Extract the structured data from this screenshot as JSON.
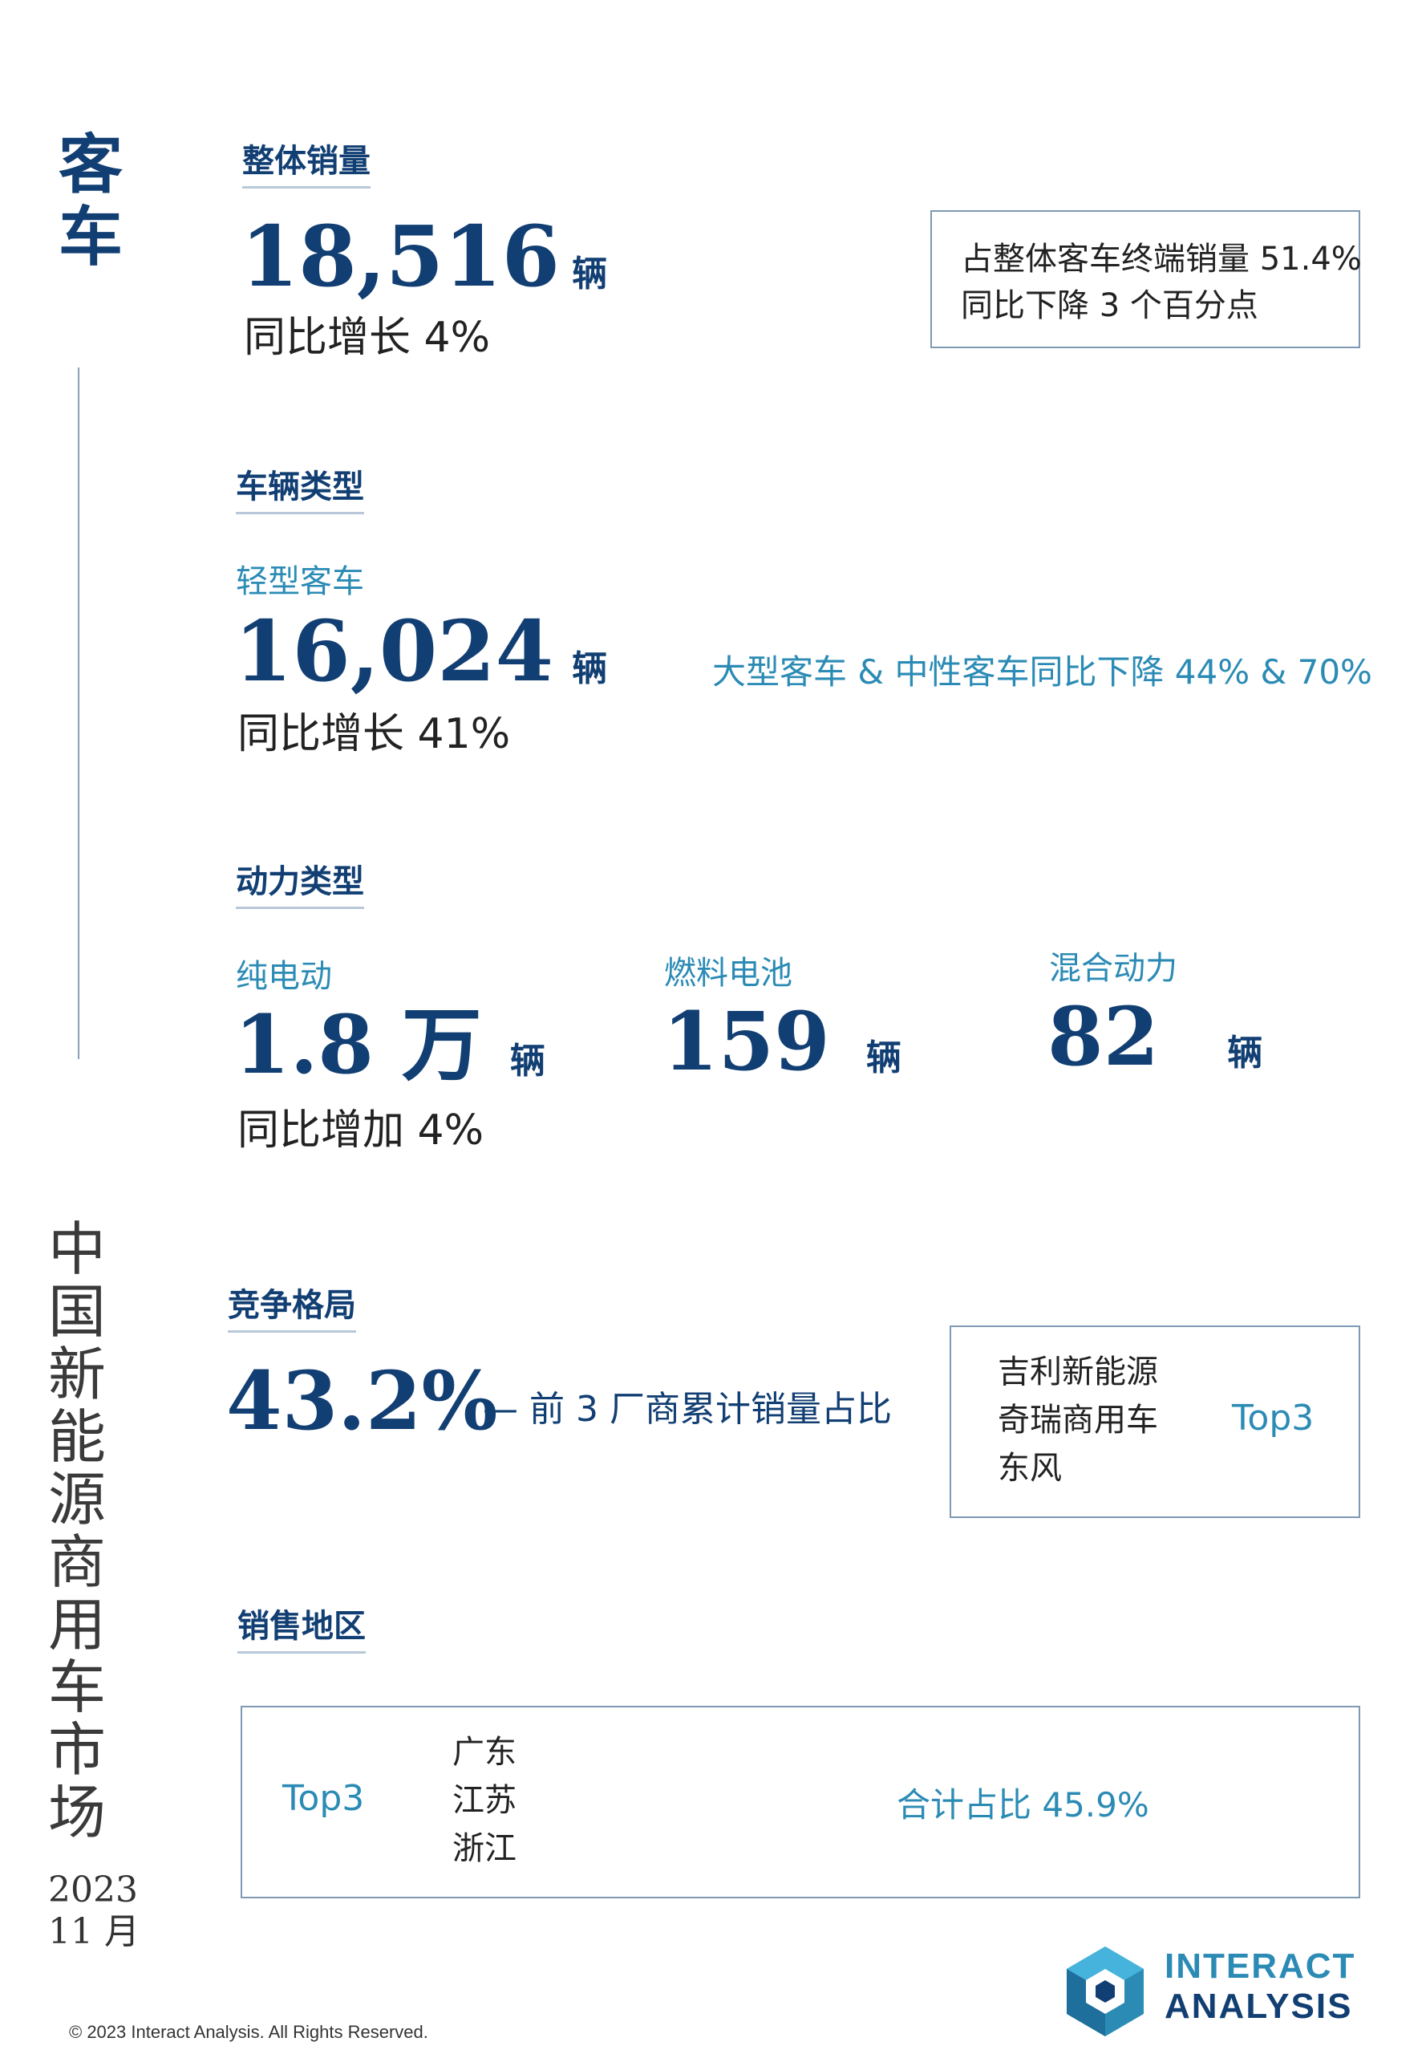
{
  "side_title_top": [
    "客",
    "车"
  ],
  "side_title_main": [
    "中",
    "国",
    "新",
    "能",
    "源",
    "商",
    "用",
    "车",
    "市",
    "场"
  ],
  "date": {
    "year": "2023",
    "month": "11 月"
  },
  "overall": {
    "heading": "整体销量",
    "number": "18,516",
    "unit": "辆",
    "growth": "同比增长 4%",
    "box_line1": "占整体客车终端销量 51.4%",
    "box_line2": "同比下降 3 个百分点"
  },
  "vehicle_type": {
    "heading": "车辆类型",
    "sub": "轻型客车",
    "number": "16,024",
    "unit": "辆",
    "growth": "同比增长 41%",
    "note": "大型客车 & 中性客车同比下降 44% & 70%"
  },
  "power_type": {
    "heading": "动力类型",
    "items": [
      {
        "label": "纯电动",
        "number": "1.8 万",
        "unit": "辆",
        "growth": "同比增加 4%"
      },
      {
        "label": "燃料电池",
        "number": "159",
        "unit": "辆"
      },
      {
        "label": "混合动力",
        "number": "82",
        "unit": "辆"
      }
    ]
  },
  "competition": {
    "heading": "竞争格局",
    "number": "43.2%",
    "desc": "— 前 3 厂商累计销量占比",
    "companies": [
      "吉利新能源",
      "奇瑞商用车",
      "东风"
    ],
    "badge": "Top3"
  },
  "region": {
    "heading": "销售地区",
    "badge": "Top3",
    "regions": [
      "广东",
      "江苏",
      "浙江"
    ],
    "total": "合计占比 45.9%"
  },
  "logo": {
    "line1": "INTERACT",
    "line2": "ANALYSIS"
  },
  "copyright": "© 2023 Interact Analysis. All Rights Reserved.",
  "colors": {
    "navy": "#123f73",
    "teal": "#2b8bb5",
    "border": "#7f98b4"
  }
}
